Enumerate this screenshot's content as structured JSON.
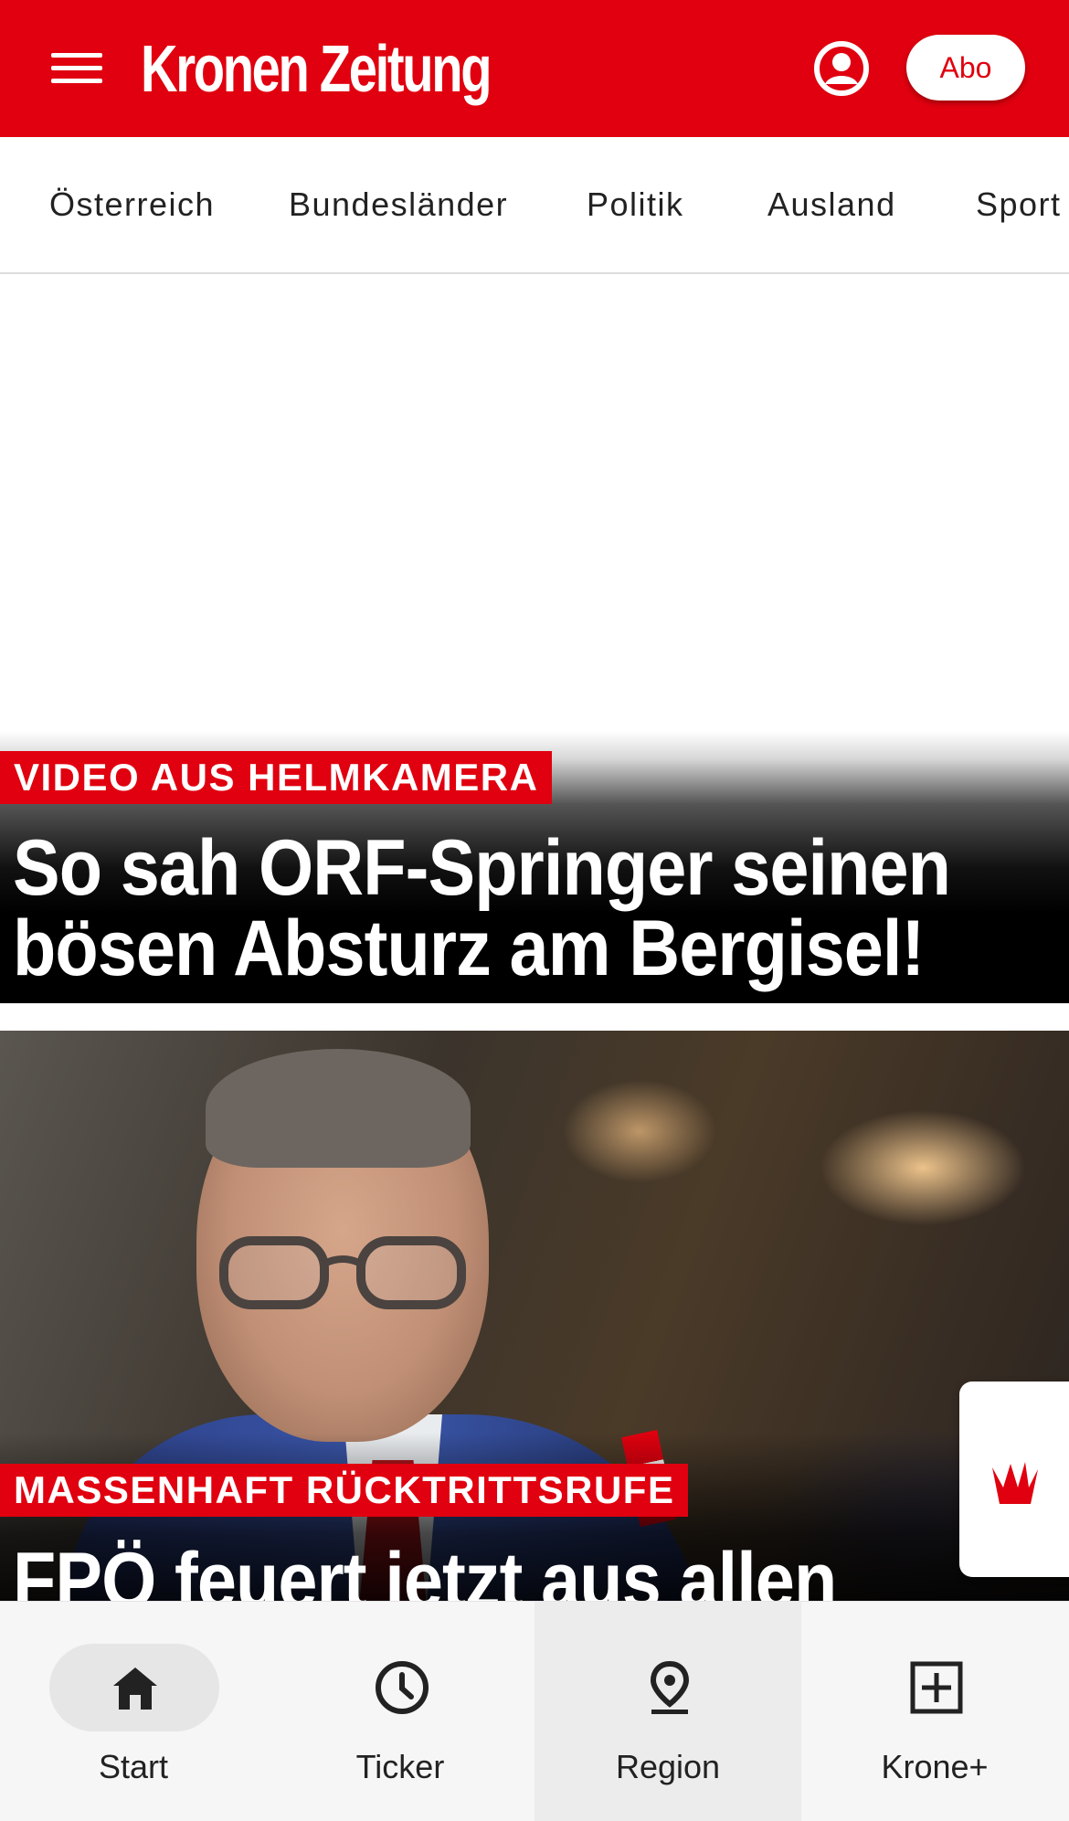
{
  "header": {
    "brand": "Kronen Zeitung",
    "abo_label": "Abo",
    "brand_color": "#e0000f",
    "icons": [
      "menu-icon",
      "user-account-icon"
    ]
  },
  "categories": [
    "Österreich",
    "Bundesländer",
    "Politik",
    "Ausland",
    "Sport"
  ],
  "teasers": [
    {
      "kicker": "VIDEO AUS HELMKAMERA",
      "headline_line1": "So sah ORF-Springer seinen",
      "headline_line2": "bösen Absturz am Bergisel!"
    },
    {
      "kicker": "MASSENHAFT RÜCKTRITTSRUFE",
      "headline_line1": "FPÖ feuert jetzt aus allen"
    }
  ],
  "floating_tab": {
    "icon": "krone-crown-icon"
  },
  "bottom_nav": {
    "items": [
      {
        "label": "Start",
        "icon": "home-icon",
        "active": true
      },
      {
        "label": "Ticker",
        "icon": "clock-icon",
        "active": false
      },
      {
        "label": "Region",
        "icon": "location-pin-icon",
        "active": false
      },
      {
        "label": "Krone+",
        "icon": "plus-box-icon",
        "active": false
      }
    ]
  }
}
